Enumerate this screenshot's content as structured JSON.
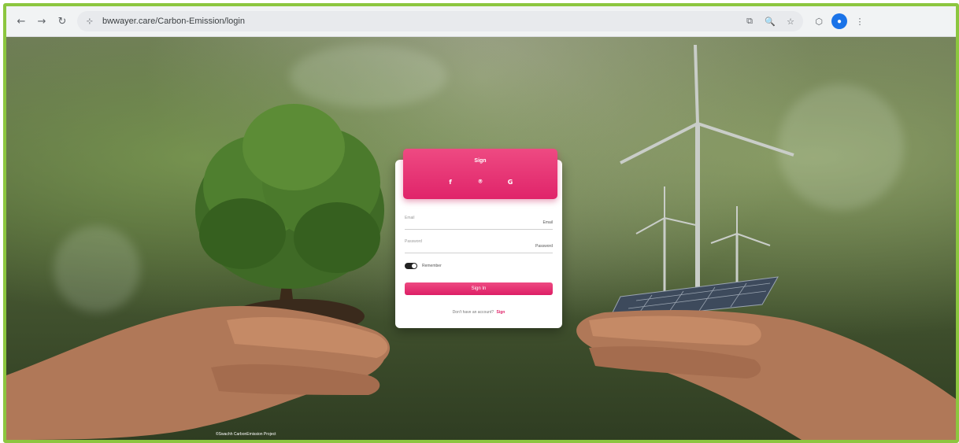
{
  "browser": {
    "url": "bwwayer.care/Carbon-Emission/login",
    "back_icon": "←",
    "forward_icon": "→",
    "reload_icon": "↻",
    "site_info_icon": "⊹",
    "translate_icon": "⧉",
    "zoom_icon": "🔍",
    "bookmark_icon": "☆",
    "extensions_icon": "⬡",
    "profile_icon": "●",
    "menu_icon": "⋮"
  },
  "login": {
    "title": "Sign",
    "social": {
      "facebook": "f",
      "github": "⌾",
      "google": "G"
    },
    "email_label": "Email",
    "email_value": "Email",
    "password_label": "Password",
    "password_value": "Password",
    "remember_label": "Remember",
    "signin_label": "Sign In",
    "signup_prompt": "Don't have an account?",
    "signup_link": "Sign"
  },
  "footer": {
    "caption": "©Swachh CarbonEmission Project"
  },
  "colors": {
    "accent": "#e0246a",
    "frame_border": "#8cc63f"
  }
}
